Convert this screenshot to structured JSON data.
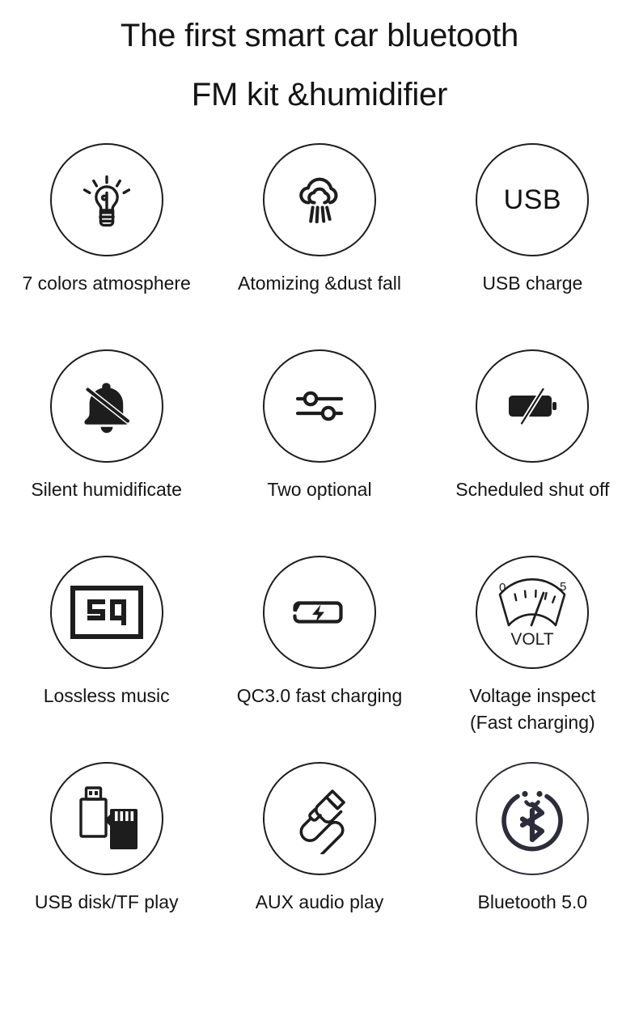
{
  "title": {
    "line1": "The first smart car bluetooth",
    "line2": "FM kit &humidifier"
  },
  "colors": {
    "stroke": "#1d1d1d",
    "text": "#151515",
    "bluetooth": "#2c2c3a",
    "background": "#ffffff"
  },
  "features": [
    {
      "icon": "lightbulb-icon",
      "label": "7 colors atmosphere"
    },
    {
      "icon": "mist-cloud-icon",
      "label": "Atomizing &dust fall"
    },
    {
      "icon": "usb-text-icon",
      "icon_text": "USB",
      "label": "USB charge"
    },
    {
      "icon": "bell-muted-icon",
      "label": "Silent humidificate"
    },
    {
      "icon": "sliders-icon",
      "label": "Two optional"
    },
    {
      "icon": "battery-off-icon",
      "label": "Scheduled shut off"
    },
    {
      "icon": "sq-lossless-icon",
      "icon_text": "SQ",
      "label": "Lossless music"
    },
    {
      "icon": "battery-bolt-icon",
      "label": "QC3.0 fast charging"
    },
    {
      "icon": "volt-gauge-icon",
      "gauge_min": "0",
      "gauge_max": "5",
      "gauge_unit": "VOLT",
      "label": "Voltage inspect\n(Fast charging)"
    },
    {
      "icon": "usb-drive-tf-card-icon",
      "label": "USB disk/TF play"
    },
    {
      "icon": "aux-cable-icon",
      "label": "AUX audio play"
    },
    {
      "icon": "bluetooth-smiley-icon",
      "label": "Bluetooth 5.0"
    }
  ]
}
